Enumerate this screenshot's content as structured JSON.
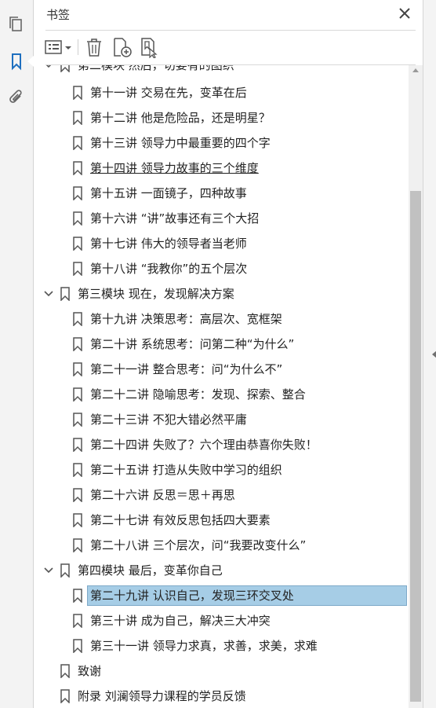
{
  "panel": {
    "title": "书签"
  },
  "sidebar": {
    "icons": [
      "pages-icon",
      "bookmark-icon",
      "attachment-icon"
    ]
  },
  "toolbar": {
    "buttons": [
      "options-menu",
      "delete",
      "new-bookmark",
      "new-bookmark-from-structure"
    ]
  },
  "colors": {
    "accent": "#1e6fbf",
    "selection": "#a6cde6"
  },
  "bookmarks": [
    {
      "label": "第二模块 然后，切要有的图织"
    },
    {
      "label": "第十一讲 交易在先，变革在后"
    },
    {
      "label": "第十二讲 他是危险品，还是明星？"
    },
    {
      "label": "第十三讲 领导力中最重要的四个字"
    },
    {
      "label": "第十四讲 领导力故事的三个维度"
    },
    {
      "label": "第十五讲 一面镜子，四种故事"
    },
    {
      "label": "第十六讲 “讲”故事还有三个大招"
    },
    {
      "label": "第十七讲 伟大的领导者当老师"
    },
    {
      "label": "第十八讲 “我教你”的五个层次"
    },
    {
      "label": "第三模块 现在，发现解决方案"
    },
    {
      "label": "第十九讲 决策思考：高层次、宽框架"
    },
    {
      "label": "第二十讲 系统思考：问第二种“为什么”"
    },
    {
      "label": "第二十一讲 整合思考：问“为什么不”"
    },
    {
      "label": "第二十二讲 隐喻思考：发现、探索、整合"
    },
    {
      "label": "第二十三讲 不犯大错必然平庸"
    },
    {
      "label": "第二十四讲 失败了？六个理由恭喜你失败！"
    },
    {
      "label": "第二十五讲 打造从失败中学习的组织"
    },
    {
      "label": "第二十六讲 反思＝思＋再思"
    },
    {
      "label": "第二十七讲 有效反思包括四大要素"
    },
    {
      "label": "第二十八讲 三个层次，问“我要改变什么”"
    },
    {
      "label": "第四模块 最后，变革你自己"
    },
    {
      "label": "第二十九讲 认识自己，发现三环交叉处"
    },
    {
      "label": "第三十讲 成为自己，解决三大冲突"
    },
    {
      "label": "第三十一讲 领导力求真，求善，求美，求难"
    },
    {
      "label": "致谢"
    },
    {
      "label": "附录 刘澜领导力课程的学员反馈"
    }
  ]
}
